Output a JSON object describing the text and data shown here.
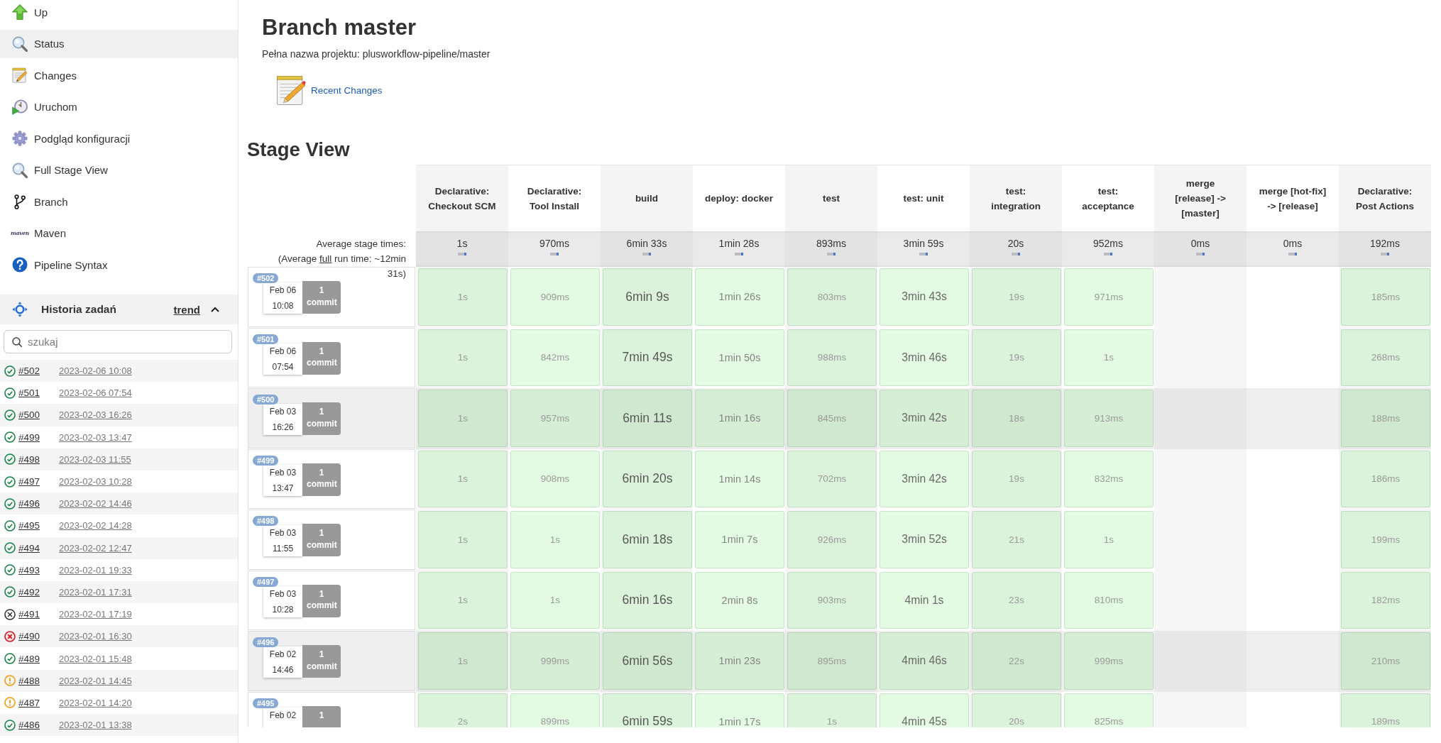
{
  "sidebar": {
    "items": [
      {
        "kind": "up",
        "label": "Up",
        "selected": false
      },
      {
        "kind": "status",
        "label": "Status",
        "selected": true
      },
      {
        "kind": "changes",
        "label": "Changes",
        "selected": false
      },
      {
        "kind": "build",
        "label": "Uruchom",
        "selected": false
      },
      {
        "kind": "config",
        "label": "Podgląd konfiguracji",
        "selected": false
      },
      {
        "kind": "stages",
        "label": "Full Stage View",
        "selected": false
      },
      {
        "kind": "branch",
        "label": "Branch",
        "selected": false
      },
      {
        "kind": "maven",
        "label": "Maven",
        "logo_text": "maven",
        "selected": false
      },
      {
        "kind": "help",
        "label": "Pipeline Syntax",
        "selected": false
      }
    ]
  },
  "build_history": {
    "title": "Historia zadań",
    "trend_link": "trend",
    "expanded": true,
    "search": {
      "placeholder": "szukaj"
    },
    "builds": [
      {
        "number": "#502",
        "date": "2023-02-06 10:08",
        "kind": "success"
      },
      {
        "number": "#501",
        "date": "2023-02-06 07:54",
        "kind": "success"
      },
      {
        "number": "#500",
        "date": "2023-02-03 16:26",
        "kind": "success"
      },
      {
        "number": "#499",
        "date": "2023-02-03 13:47",
        "kind": "success"
      },
      {
        "number": "#498",
        "date": "2023-02-03 11:55",
        "kind": "success"
      },
      {
        "number": "#497",
        "date": "2023-02-03 10:28",
        "kind": "success"
      },
      {
        "number": "#496",
        "date": "2023-02-02 14:46",
        "kind": "success"
      },
      {
        "number": "#495",
        "date": "2023-02-02 14:28",
        "kind": "success"
      },
      {
        "number": "#494",
        "date": "2023-02-02 12:47",
        "kind": "success"
      },
      {
        "number": "#493",
        "date": "2023-02-01 19:33",
        "kind": "success"
      },
      {
        "number": "#492",
        "date": "2023-02-01 17:31",
        "kind": "success"
      },
      {
        "number": "#491",
        "date": "2023-02-01 17:19",
        "kind": "aborted"
      },
      {
        "number": "#490",
        "date": "2023-02-01 16:30",
        "kind": "failed"
      },
      {
        "number": "#489",
        "date": "2023-02-01 15:48",
        "kind": "success"
      },
      {
        "number": "#488",
        "date": "2023-02-01 14:45",
        "kind": "unstable"
      },
      {
        "number": "#487",
        "date": "2023-02-01 14:20",
        "kind": "unstable"
      },
      {
        "number": "#486",
        "date": "2023-02-01 13:38",
        "kind": "success"
      }
    ]
  },
  "header": {
    "title": "Branch master",
    "full_name": "Pełna nazwa projektu: plusworkflow-pipeline/master",
    "recent_changes_link": "Recent Changes"
  },
  "stage_view": {
    "title": "Stage View",
    "average_label": "Average stage times:",
    "run_time": {
      "prefix": "(Average ",
      "link": "full",
      "suffix": " run time: ~12min 31s)"
    },
    "stages": [
      {
        "name": "Declarative: Checkout SCM",
        "average": "1s",
        "kind": "fast"
      },
      {
        "name": "Declarative: Tool Install",
        "average": "970ms",
        "kind": "fast"
      },
      {
        "name": "build",
        "average": "6min 33s",
        "kind": "slowest"
      },
      {
        "name": "deploy: docker",
        "average": "1min 28s",
        "kind": "moderate"
      },
      {
        "name": "test",
        "average": "893ms",
        "kind": "fast"
      },
      {
        "name": "test: unit",
        "average": "3min 59s",
        "kind": "slow"
      },
      {
        "name": "test: integration",
        "average": "20s",
        "kind": "fast"
      },
      {
        "name": "test: acceptance",
        "average": "952ms",
        "kind": "fast"
      },
      {
        "name": "merge [release] -> [master]",
        "average": "0ms"
      },
      {
        "name": "merge [hot-fix] -> [release]",
        "average": "0ms"
      },
      {
        "name": "Declarative: Post Actions",
        "average": "192ms",
        "kind": "fast"
      }
    ],
    "runs": [
      {
        "number": "#502",
        "date": "Feb 06",
        "time": "10:08",
        "changes": "1 commit",
        "highlighted": false,
        "stages": [
          {
            "kind": "success",
            "duration": "1s"
          },
          {
            "kind": "success",
            "duration": "909ms"
          },
          {
            "kind": "success",
            "duration": "6min 9s"
          },
          {
            "kind": "success",
            "duration": "1min 26s"
          },
          {
            "kind": "success",
            "duration": "803ms"
          },
          {
            "kind": "success",
            "duration": "3min 43s"
          },
          {
            "kind": "success",
            "duration": "19s"
          },
          {
            "kind": "success",
            "duration": "971ms"
          },
          {
            "kind": "not_executed"
          },
          {
            "kind": "not_executed"
          },
          {
            "kind": "success",
            "duration": "185ms"
          }
        ]
      },
      {
        "number": "#501",
        "date": "Feb 06",
        "time": "07:54",
        "changes": "1 commit",
        "highlighted": false,
        "stages": [
          {
            "kind": "success",
            "duration": "1s"
          },
          {
            "kind": "success",
            "duration": "842ms"
          },
          {
            "kind": "success",
            "duration": "7min 49s"
          },
          {
            "kind": "success",
            "duration": "1min 50s"
          },
          {
            "kind": "success",
            "duration": "988ms"
          },
          {
            "kind": "success",
            "duration": "3min 46s"
          },
          {
            "kind": "success",
            "duration": "19s"
          },
          {
            "kind": "success",
            "duration": "1s"
          },
          {
            "kind": "not_executed"
          },
          {
            "kind": "not_executed"
          },
          {
            "kind": "success",
            "duration": "268ms"
          }
        ]
      },
      {
        "number": "#500",
        "date": "Feb 03",
        "time": "16:26",
        "changes": "1 commit",
        "highlighted": true,
        "stages": [
          {
            "kind": "success",
            "duration": "1s"
          },
          {
            "kind": "success",
            "duration": "957ms"
          },
          {
            "kind": "success",
            "duration": "6min 11s"
          },
          {
            "kind": "success",
            "duration": "1min 16s"
          },
          {
            "kind": "success",
            "duration": "845ms"
          },
          {
            "kind": "success",
            "duration": "3min 42s"
          },
          {
            "kind": "success",
            "duration": "18s"
          },
          {
            "kind": "success",
            "duration": "913ms"
          },
          {
            "kind": "not_executed"
          },
          {
            "kind": "not_executed"
          },
          {
            "kind": "success",
            "duration": "188ms"
          }
        ]
      },
      {
        "number": "#499",
        "date": "Feb 03",
        "time": "13:47",
        "changes": "1 commit",
        "highlighted": false,
        "stages": [
          {
            "kind": "success",
            "duration": "1s"
          },
          {
            "kind": "success",
            "duration": "908ms"
          },
          {
            "kind": "success",
            "duration": "6min 20s"
          },
          {
            "kind": "success",
            "duration": "1min 14s"
          },
          {
            "kind": "success",
            "duration": "702ms"
          },
          {
            "kind": "success",
            "duration": "3min 42s"
          },
          {
            "kind": "success",
            "duration": "19s"
          },
          {
            "kind": "success",
            "duration": "832ms"
          },
          {
            "kind": "not_executed"
          },
          {
            "kind": "not_executed"
          },
          {
            "kind": "success",
            "duration": "186ms"
          }
        ]
      },
      {
        "number": "#498",
        "date": "Feb 03",
        "time": "11:55",
        "changes": "1 commit",
        "highlighted": false,
        "stages": [
          {
            "kind": "success",
            "duration": "1s"
          },
          {
            "kind": "success",
            "duration": "1s"
          },
          {
            "kind": "success",
            "duration": "6min 18s"
          },
          {
            "kind": "success",
            "duration": "1min 7s"
          },
          {
            "kind": "success",
            "duration": "926ms"
          },
          {
            "kind": "success",
            "duration": "3min 52s"
          },
          {
            "kind": "success",
            "duration": "21s"
          },
          {
            "kind": "success",
            "duration": "1s"
          },
          {
            "kind": "not_executed"
          },
          {
            "kind": "not_executed"
          },
          {
            "kind": "success",
            "duration": "199ms"
          }
        ]
      },
      {
        "number": "#497",
        "date": "Feb 03",
        "time": "10:28",
        "changes": "1 commit",
        "highlighted": false,
        "stages": [
          {
            "kind": "success",
            "duration": "1s"
          },
          {
            "kind": "success",
            "duration": "1s"
          },
          {
            "kind": "success",
            "duration": "6min 16s"
          },
          {
            "kind": "success",
            "duration": "2min 8s"
          },
          {
            "kind": "success",
            "duration": "903ms"
          },
          {
            "kind": "success",
            "duration": "4min 1s"
          },
          {
            "kind": "success",
            "duration": "23s"
          },
          {
            "kind": "success",
            "duration": "810ms"
          },
          {
            "kind": "not_executed"
          },
          {
            "kind": "not_executed"
          },
          {
            "kind": "success",
            "duration": "182ms"
          }
        ]
      },
      {
        "number": "#496",
        "date": "Feb 02",
        "time": "14:46",
        "changes": "1 commit",
        "highlighted": true,
        "stages": [
          {
            "kind": "success",
            "duration": "1s"
          },
          {
            "kind": "success",
            "duration": "999ms"
          },
          {
            "kind": "success",
            "duration": "6min 56s"
          },
          {
            "kind": "success",
            "duration": "1min 23s"
          },
          {
            "kind": "success",
            "duration": "895ms"
          },
          {
            "kind": "success",
            "duration": "4min 46s"
          },
          {
            "kind": "success",
            "duration": "22s"
          },
          {
            "kind": "success",
            "duration": "999ms"
          },
          {
            "kind": "not_executed"
          },
          {
            "kind": "not_executed"
          },
          {
            "kind": "success",
            "duration": "210ms"
          }
        ]
      },
      {
        "number": "#495",
        "date": "Feb 02",
        "changes": "1",
        "highlighted": false,
        "stages": [
          {
            "kind": "success",
            "duration": "2s"
          },
          {
            "kind": "success",
            "duration": "899ms"
          },
          {
            "kind": "success",
            "duration": "6min 59s"
          },
          {
            "kind": "success",
            "duration": "1min 17s"
          },
          {
            "kind": "success",
            "duration": "1s"
          },
          {
            "kind": "success",
            "duration": "4min 45s"
          },
          {
            "kind": "success",
            "duration": "20s"
          },
          {
            "kind": "success",
            "duration": "825ms"
          },
          {
            "kind": "not_executed"
          },
          {
            "kind": "not_executed"
          },
          {
            "kind": "success",
            "duration": "189ms"
          }
        ]
      }
    ]
  }
}
